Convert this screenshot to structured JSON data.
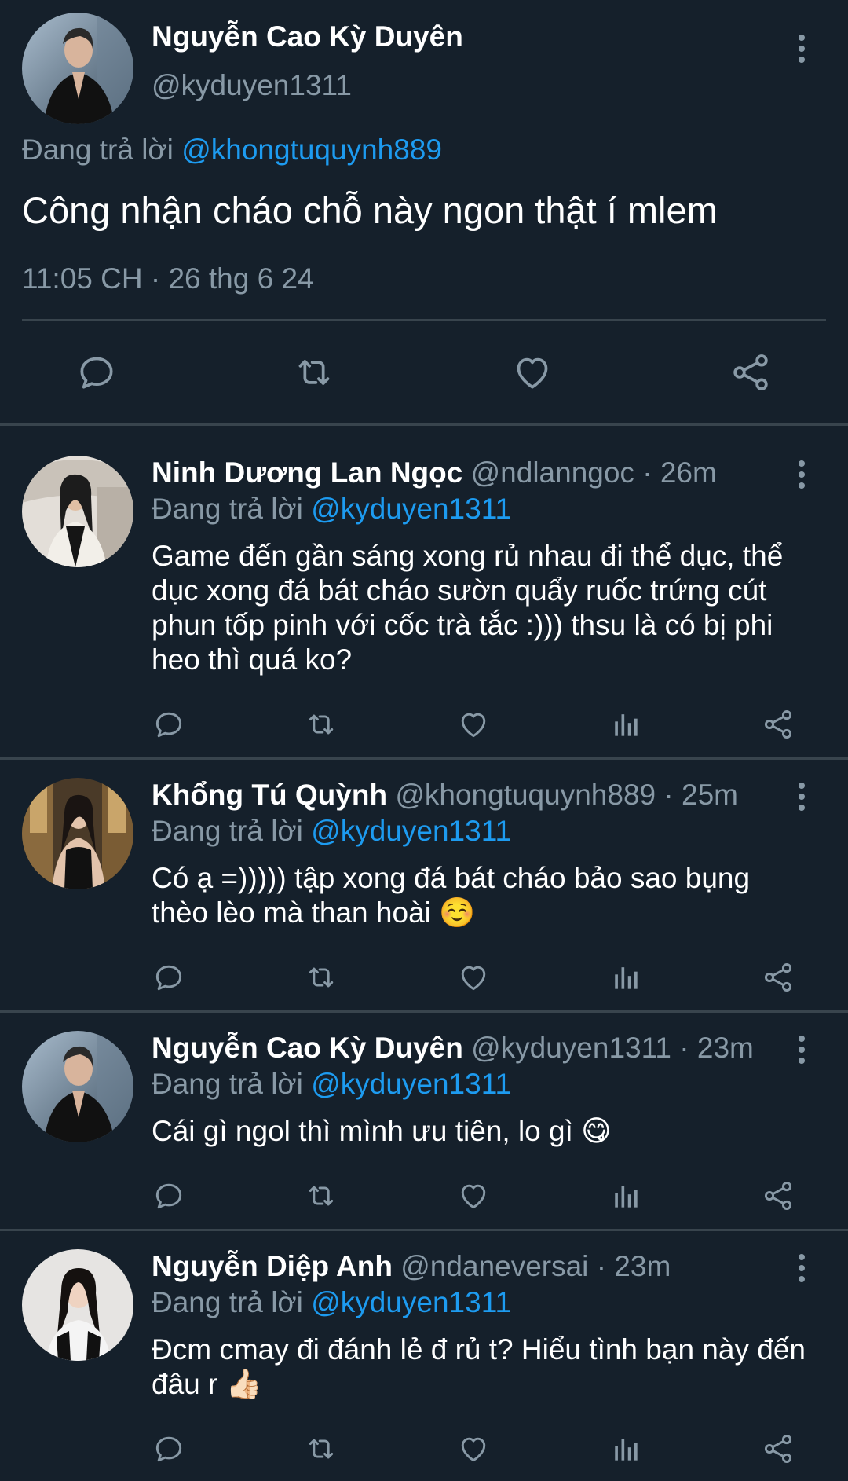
{
  "main_tweet": {
    "author_name": "Nguyễn Cao Kỳ Duyên",
    "author_handle": "@kyduyen1311",
    "replying_label": "Đang trả lời",
    "replying_to": "@khongtuquynh889",
    "text": "Công nhận cháo chỗ này ngon thật í mlem",
    "timestamp": "11:05 CH · 26 thg 6 24",
    "actions": [
      "reply-icon",
      "retweet-icon",
      "like-icon",
      "share-icon"
    ]
  },
  "replies": [
    {
      "author_name": "Ninh Dương Lan Ngọc",
      "author_handle": "@ndlanngoc",
      "time": "· 26m",
      "replying_label": "Đang trả lời",
      "replying_to": "@kyduyen1311",
      "text": "Game đến gần sáng xong rủ nhau đi thể dục, thể dục xong đá bát cháo sườn quẩy ruốc trứng cút phun tốp pinh với cốc trà tắc :))) thsu là có bị phi heo thì quá ko?"
    },
    {
      "author_name": "Khổng Tú Quỳnh",
      "author_handle": "@khongtuquynh889",
      "time": "· 25m",
      "replying_label": "Đang trả lời",
      "replying_to": "@kyduyen1311",
      "text": "Có ạ =))))) tập xong đá bát cháo bảo sao bụng thèo lèo mà than hoài ☺️"
    },
    {
      "author_name": "Nguyễn Cao Kỳ Duyên",
      "author_handle": "@kyduyen1311",
      "time": "· 23m",
      "replying_label": "Đang trả lời",
      "replying_to": "@kyduyen1311",
      "text": "Cái gì ngol thì mình ưu tiên, lo gì 😋"
    },
    {
      "author_name": "Nguyễn Diệp Anh",
      "author_handle": "@ndaneversai",
      "time": "· 23m",
      "replying_label": "Đang trả lời",
      "replying_to": "@kyduyen1311",
      "text": "Đcm cmay đi đánh lẻ đ rủ t? Hiểu tình bạn này đến đâu r 👍🏻"
    }
  ],
  "colors": {
    "background": "#15202b",
    "divider": "#38444d",
    "secondary_text": "#8899a6",
    "accent": "#1d9bf0"
  }
}
